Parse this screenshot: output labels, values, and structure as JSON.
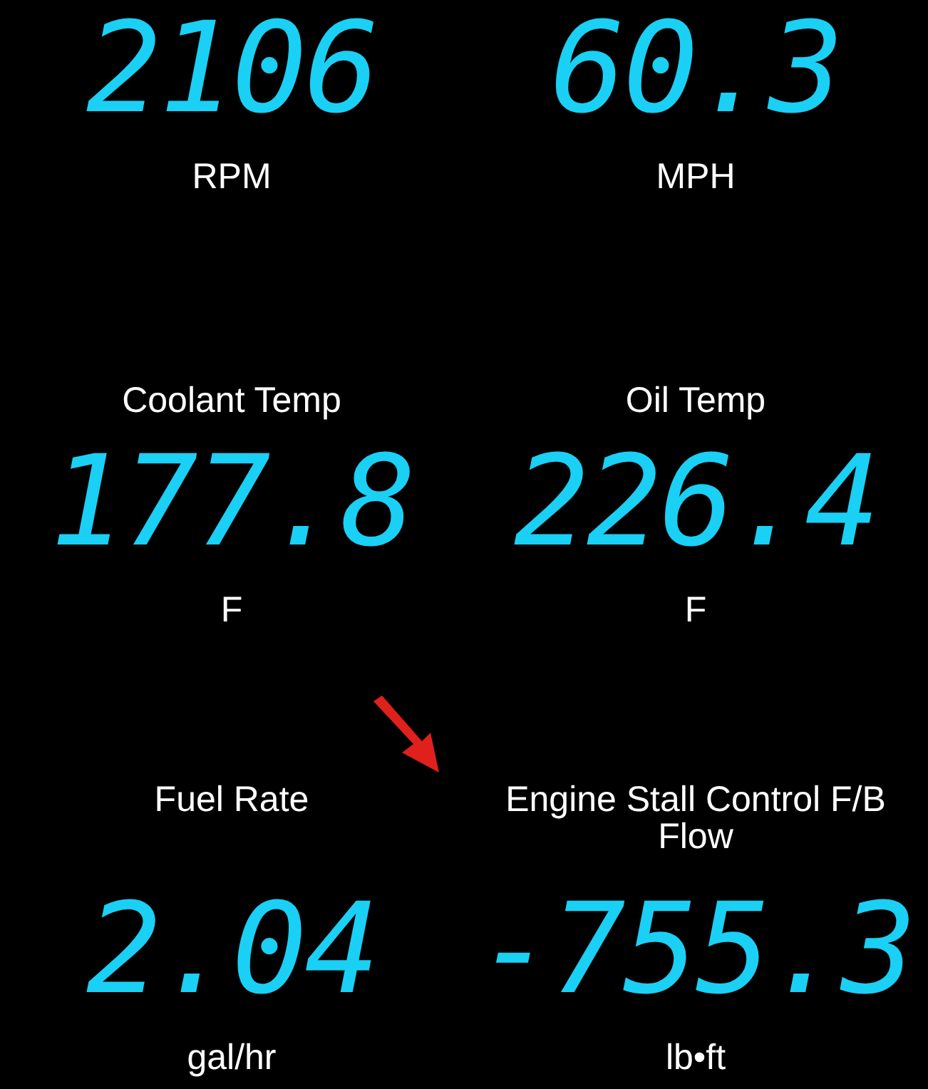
{
  "gauges": [
    {
      "kind": "value_first",
      "value": "2106",
      "caption": "RPM"
    },
    {
      "kind": "value_first",
      "value": "60.3",
      "caption": "MPH"
    },
    {
      "kind": "label_first",
      "label": "Coolant Temp",
      "value": "177.8",
      "caption": "F"
    },
    {
      "kind": "label_first",
      "label": "Oil Temp",
      "value": "226.4",
      "caption": "F"
    },
    {
      "kind": "label_first",
      "label": "Fuel Rate",
      "value": "2.04",
      "caption": "gal/hr"
    },
    {
      "kind": "label_first",
      "label": "Engine Stall Control F/B Flow",
      "value": "-755.3",
      "caption": "lb•ft"
    }
  ]
}
